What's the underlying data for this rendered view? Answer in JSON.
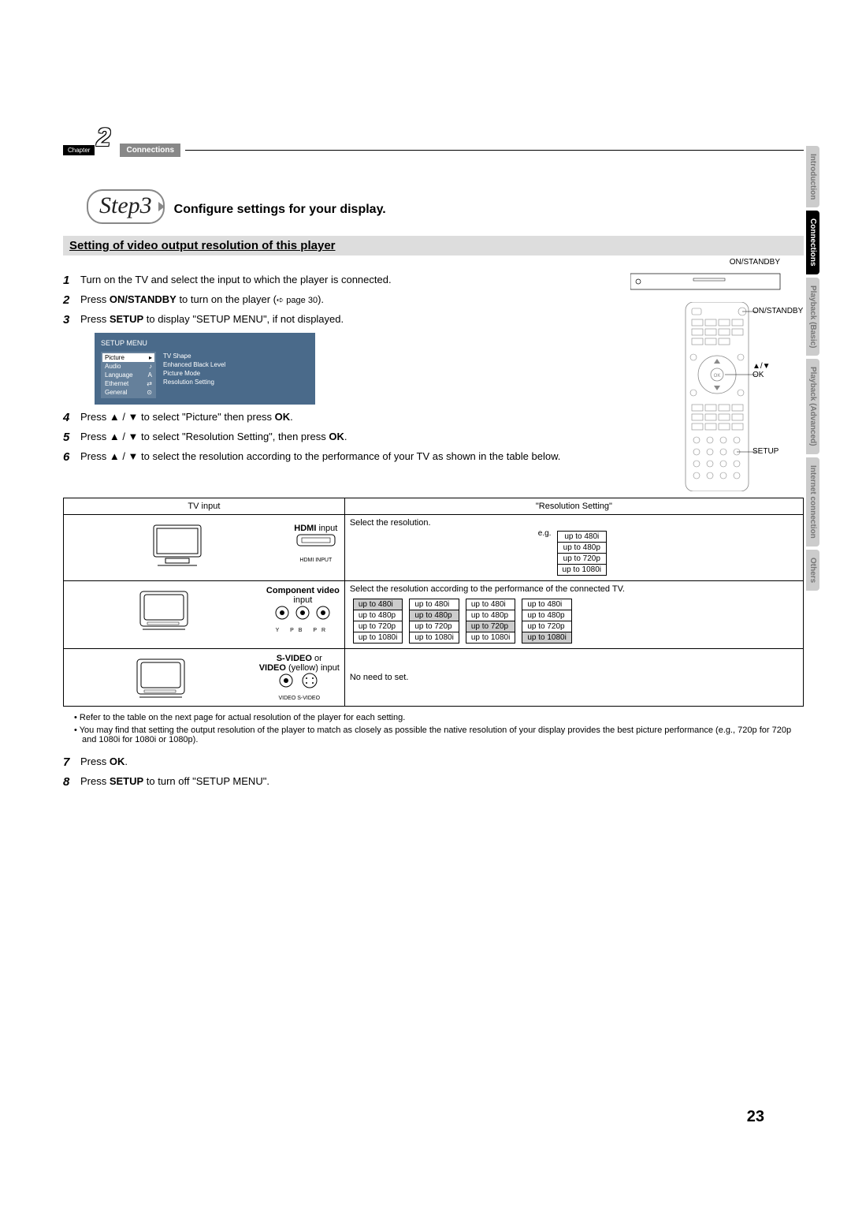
{
  "chapter": {
    "badge": "Chapter",
    "number": "2",
    "label": "Connections"
  },
  "step": {
    "label": "Step3",
    "title": "Configure settings for your display."
  },
  "section_heading": "Setting of video output resolution of this player",
  "steps": {
    "s1": "Turn on the TV and select the input to which the player is connected.",
    "s2_a": "Press ",
    "s2_b": "ON/STANDBY",
    "s2_c": " to turn on the player (",
    "s2_ref": "page 30",
    "s2_d": ").",
    "s3_a": "Press ",
    "s3_b": "SETUP",
    "s3_c": " to display \"SETUP MENU\", if not displayed.",
    "s4_a": "Press ▲ / ▼ to select \"Picture\" then press ",
    "s4_b": "OK",
    "s4_c": ".",
    "s5_a": "Press ▲ / ▼ to select \"Resolution Setting\", then press ",
    "s5_b": "OK",
    "s5_c": ".",
    "s6": "Press ▲ / ▼ to select the resolution according to the performance of your TV as shown in the table below.",
    "s7_a": "Press ",
    "s7_b": "OK",
    "s7_c": ".",
    "s8_a": "Press ",
    "s8_b": "SETUP",
    "s8_c": " to turn off \"SETUP MENU\"."
  },
  "setup_menu": {
    "title": "SETUP MENU",
    "left": [
      "Picture",
      "Audio",
      "Language",
      "Ethernet",
      "General"
    ],
    "right": [
      "TV Shape",
      "Enhanced Black Level",
      "Picture Mode",
      "Resolution Setting"
    ]
  },
  "remote": {
    "on_standby_top": "ON/STANDBY",
    "on_standby": "ON/STANDBY",
    "arrows_ok": "▲/▼\nOK",
    "setup": "SETUP"
  },
  "table": {
    "head_left": "TV input",
    "head_right": "\"Resolution Setting\"",
    "row1": {
      "title_b": "HDMI",
      "title_rest": " input",
      "port_label": "HDMI INPUT",
      "right_a": "Select the resolution.",
      "eg": "e.g.",
      "opts": [
        "up to 480i",
        "up to 480p",
        "up to 720p",
        "up to 1080i"
      ]
    },
    "row2": {
      "title_b": "Component video",
      "title_rest": "input",
      "port_labels": "Y    PB    PR",
      "right_a": "Select the resolution according to the performance of the connected TV.",
      "cols": [
        {
          "opts": [
            "up to 480i",
            "up to 480p",
            "up to 720p",
            "up to 1080i"
          ],
          "sel": 0
        },
        {
          "opts": [
            "up to 480i",
            "up to 480p",
            "up to 720p",
            "up to 1080i"
          ],
          "sel": 1
        },
        {
          "opts": [
            "up to 480i",
            "up to 480p",
            "up to 720p",
            "up to 1080i"
          ],
          "sel": 2
        },
        {
          "opts": [
            "up to 480i",
            "up to 480p",
            "up to 720p",
            "up to 1080i"
          ],
          "sel": 3
        }
      ]
    },
    "row3": {
      "title_b": "S-VIDEO",
      "title_mid": " or",
      "title_b2": "VIDEO",
      "title_rest": " (yellow) input",
      "port_labels": "VIDEO    S-VIDEO",
      "right": "No need to set."
    }
  },
  "notes": [
    "Refer to the table on the next page for actual resolution of the player for each setting.",
    "You may find that setting the output resolution of the player to match as closely as possible the native resolution of your display provides the best picture performance (e.g., 720p for 720p and 1080i for 1080i or 1080p)."
  ],
  "side_tabs": [
    "Introduction",
    "Connections",
    "Playback (Basic)",
    "Playback (Advanced)",
    "Internet connection",
    "Others"
  ],
  "page_number": "23"
}
